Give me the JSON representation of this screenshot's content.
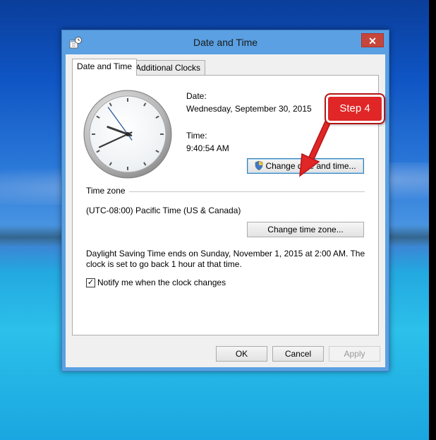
{
  "window": {
    "title": "Date and Time",
    "close_label": "✕"
  },
  "tabs": [
    {
      "label": "Date and Time",
      "active": true
    },
    {
      "label": "Additional Clocks",
      "active": false
    }
  ],
  "datetime": {
    "date_label": "Date:",
    "date_value": "Wednesday, September 30, 2015",
    "time_label": "Time:",
    "time_value": "9:40:54 AM",
    "change_button": "Change date and time..."
  },
  "timezone": {
    "heading": "Time zone",
    "value": "(UTC-08:00) Pacific Time (US & Canada)",
    "change_button": "Change time zone..."
  },
  "dst_note": "Daylight Saving Time ends on Sunday, November 1, 2015 at 2:00 AM. The clock is set to go back 1 hour at that time.",
  "notify": {
    "label": "Notify me when the clock changes",
    "checked": true,
    "check_glyph": "✓"
  },
  "footer": {
    "ok": "OK",
    "cancel": "Cancel",
    "apply": "Apply"
  },
  "annotation": {
    "label": "Step 4",
    "color": "#e02626"
  },
  "clock_time": {
    "hour": 9,
    "minute": 40,
    "second": 54
  }
}
